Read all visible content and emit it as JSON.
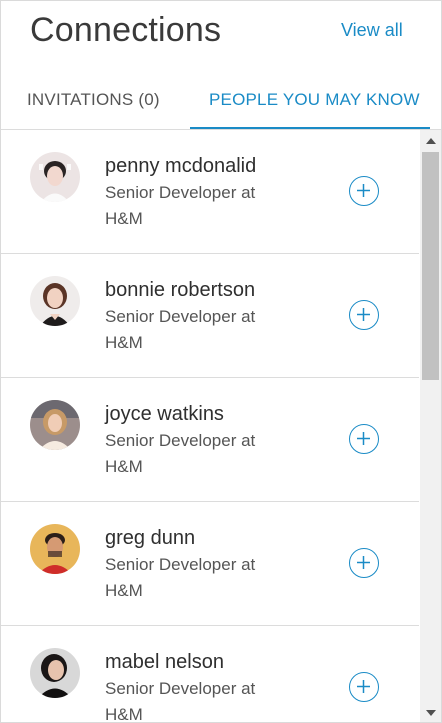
{
  "header": {
    "title": "Connections",
    "view_all_label": "View all"
  },
  "tabs": [
    {
      "label": "INVITATIONS (0)",
      "active": false
    },
    {
      "label": "PEOPLE YOU MAY KNOW",
      "active": true
    }
  ],
  "colors": {
    "accent": "#1a8bc6",
    "divider": "#dcdcdc",
    "text": "#333333"
  },
  "people": [
    {
      "name": "penny mcdonalid",
      "role": "Senior Developer at H&M",
      "avatar_icon": "person-avatar-icon",
      "action_icon": "plus-circle-icon"
    },
    {
      "name": "bonnie robertson",
      "role": "Senior Developer at H&M",
      "avatar_icon": "person-avatar-icon",
      "action_icon": "plus-circle-icon"
    },
    {
      "name": "joyce watkins",
      "role": "Senior Developer at H&M",
      "avatar_icon": "person-avatar-icon",
      "action_icon": "plus-circle-icon"
    },
    {
      "name": "greg dunn",
      "role": "Senior Developer at H&M",
      "avatar_icon": "person-avatar-icon",
      "action_icon": "plus-circle-icon"
    },
    {
      "name": "mabel nelson",
      "role": "Senior Developer at H&M",
      "avatar_icon": "person-avatar-icon",
      "action_icon": "plus-circle-icon"
    }
  ]
}
